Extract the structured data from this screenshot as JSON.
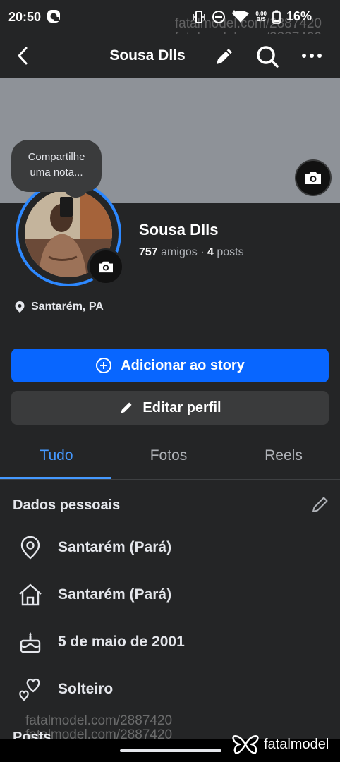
{
  "status_bar": {
    "time": "20:50",
    "speed_top": "0.00",
    "speed_bottom": "B/S",
    "battery": "16%"
  },
  "watermark": {
    "line1": "fatalmodel.com/2887420",
    "line2": "fatalmodel.com/2887420"
  },
  "header": {
    "title": "Sousa Dlls",
    "icons": [
      "back-arrow-icon",
      "pencil-icon",
      "search-icon",
      "more-icon"
    ]
  },
  "note": {
    "text_line1": "Compartilhe",
    "text_line2": "uma nota..."
  },
  "profile": {
    "name": "Sousa Dlls",
    "friends_count": "757",
    "friends_label": "amigos",
    "separator": "·",
    "posts_count": "4",
    "posts_label": "posts",
    "location": "Santarém, PA"
  },
  "buttons": {
    "add_story": "Adicionar ao story",
    "edit_profile": "Editar perfil"
  },
  "tabs": [
    {
      "label": "Tudo",
      "active": true
    },
    {
      "label": "Fotos",
      "active": false
    },
    {
      "label": "Reels",
      "active": false
    }
  ],
  "personal": {
    "title": "Dados pessoais",
    "items": [
      {
        "icon": "location-pin-icon",
        "text": "Santarém (Pará)"
      },
      {
        "icon": "home-icon",
        "text": "Santarém (Pará)"
      },
      {
        "icon": "birthday-cake-icon",
        "text": "5 de maio de 2001"
      },
      {
        "icon": "hearts-icon",
        "text": "Solteiro"
      }
    ]
  },
  "posts_section": {
    "title": "Posts"
  },
  "brand": {
    "name": "fatalmodel"
  },
  "colors": {
    "background": "#242526",
    "accent": "#0866ff",
    "tab_active": "#4599ff",
    "cover": "#8e9298"
  }
}
